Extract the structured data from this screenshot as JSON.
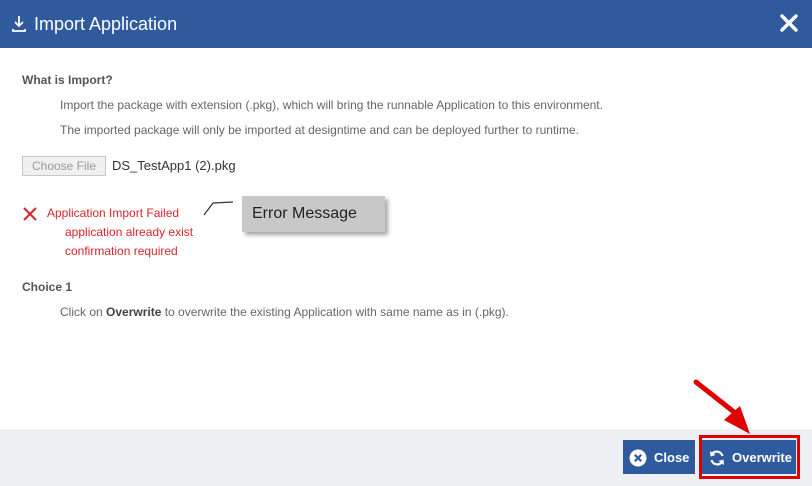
{
  "dialog": {
    "title": "Import Application",
    "icons": {
      "header": "download-icon",
      "close": "close-icon"
    }
  },
  "what_is_import": {
    "heading": "What is Import?",
    "line1": "Import the package with extension (.pkg), which will bring the runnable Application to this environment.",
    "line2": "The imported package will only be imported at designtime and can be deployed further to runtime."
  },
  "file": {
    "choose_label": "Choose File",
    "selected_name": "DS_TestApp1 (2).pkg"
  },
  "error": {
    "icon": "x-icon",
    "color": "#d9252b",
    "title": "Application Import Failed",
    "detail1": "application already exist",
    "detail2": "confirmation required"
  },
  "callout": {
    "label": "Error Message"
  },
  "choice1": {
    "heading": "Choice 1",
    "text_pre": "Click on ",
    "text_bold": "Overwrite",
    "text_post": " to overwrite the existing Application with same name as in (.pkg)."
  },
  "footer": {
    "close_label": "Close",
    "overwrite_label": "Overwrite",
    "close_icon": "circle-x-icon",
    "overwrite_icon": "refresh-icon"
  },
  "colors": {
    "header_bg": "#2f5b9e",
    "button_bg": "#2f5b9e",
    "highlight": "#e00000"
  }
}
